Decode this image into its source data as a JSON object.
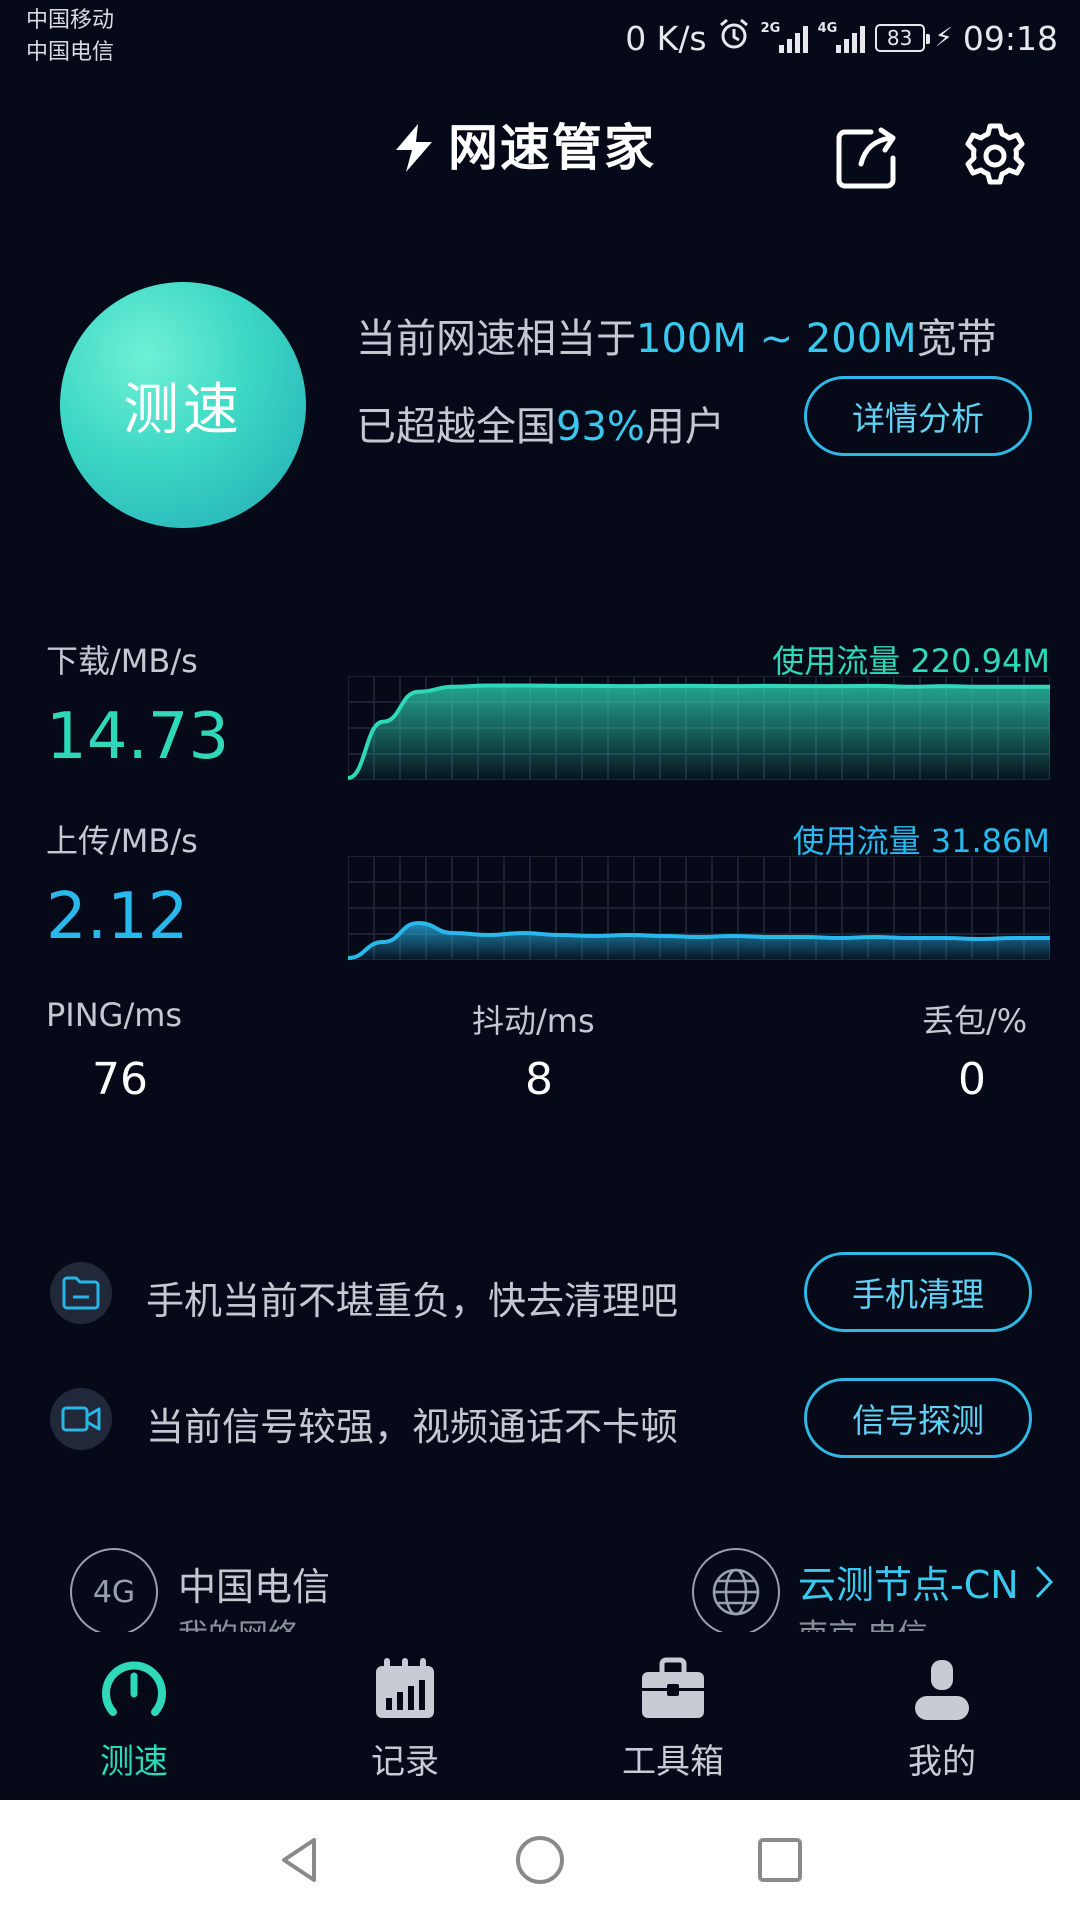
{
  "status_bar": {
    "carrier_1": "中国移动",
    "carrier_2": "中国电信",
    "net_speed": "0 K/s",
    "sig1_label": "2G",
    "sig2_label": "4G",
    "battery": "83",
    "time": "09:18"
  },
  "header": {
    "title": "网速管家",
    "share_icon": "share-icon",
    "settings_icon": "gear-icon"
  },
  "hero": {
    "speed_button_label": "测速",
    "line1_prefix": "当前网速相当于",
    "line1_highlight": "100M ~ 200M",
    "line1_suffix": "宽带",
    "line2_prefix": "已超越全国",
    "line2_highlight": "93%",
    "line2_suffix": "用户",
    "detail_button": "详情分析"
  },
  "download": {
    "label": "下载/MB/s",
    "value": "14.73",
    "usage": "使用流量 220.94M",
    "color": "#2ed8b8"
  },
  "upload": {
    "label": "上传/MB/s",
    "value": "2.12",
    "usage": "使用流量 31.86M",
    "color": "#28b8ec"
  },
  "stats": {
    "ping_label": "PING/ms",
    "ping_value": "76",
    "jitter_label": "抖动/ms",
    "jitter_value": "8",
    "loss_label": "丢包/%",
    "loss_value": "0"
  },
  "tips": [
    {
      "icon": "folder-icon",
      "text": "手机当前不堪重负，快去清理吧",
      "button": "手机清理"
    },
    {
      "icon": "video-camera-icon",
      "text": "当前信号较强，视频通话不卡顿",
      "button": "信号探测"
    }
  ],
  "network": {
    "badge": "4G",
    "carrier": "中国电信",
    "carrier_sub": "我的网络",
    "node_title": "云测节点-CN",
    "node_sub": "南京 电信"
  },
  "nav": [
    {
      "icon": "speedometer-icon",
      "label": "测速",
      "active": true
    },
    {
      "icon": "calendar-chart-icon",
      "label": "记录",
      "active": false
    },
    {
      "icon": "toolbox-icon",
      "label": "工具箱",
      "active": false
    },
    {
      "icon": "user-icon",
      "label": "我的",
      "active": false
    }
  ],
  "colors": {
    "background": "#060a18",
    "accent_teal": "#2ed8b8",
    "accent_blue": "#28b8ec"
  },
  "chart_data": [
    {
      "type": "area",
      "name": "download",
      "x": [
        0,
        1,
        2,
        3,
        4,
        5,
        6,
        7,
        8,
        9,
        10,
        11,
        12,
        13,
        14,
        15,
        16,
        17,
        18,
        19,
        20
      ],
      "values": [
        0,
        9,
        13.8,
        14.6,
        14.8,
        14.8,
        14.75,
        14.75,
        14.7,
        14.75,
        14.75,
        14.7,
        14.75,
        14.7,
        14.7,
        14.75,
        14.6,
        14.7,
        14.6,
        14.6,
        14.6
      ],
      "ylim": [
        0,
        16
      ],
      "grid": true
    },
    {
      "type": "area",
      "name": "upload",
      "x": [
        0,
        1,
        2,
        3,
        4,
        5,
        6,
        7,
        8,
        9,
        10,
        11,
        12,
        13,
        14,
        15,
        16,
        17,
        18,
        19,
        20
      ],
      "values": [
        0,
        1.6,
        3.5,
        2.5,
        2.3,
        2.5,
        2.3,
        2.2,
        2.3,
        2.2,
        2.1,
        2.2,
        2.1,
        2.1,
        2.0,
        2.1,
        2.0,
        2.0,
        1.9,
        2.0,
        2.0
      ],
      "ylim": [
        0,
        10
      ],
      "grid": true
    }
  ]
}
